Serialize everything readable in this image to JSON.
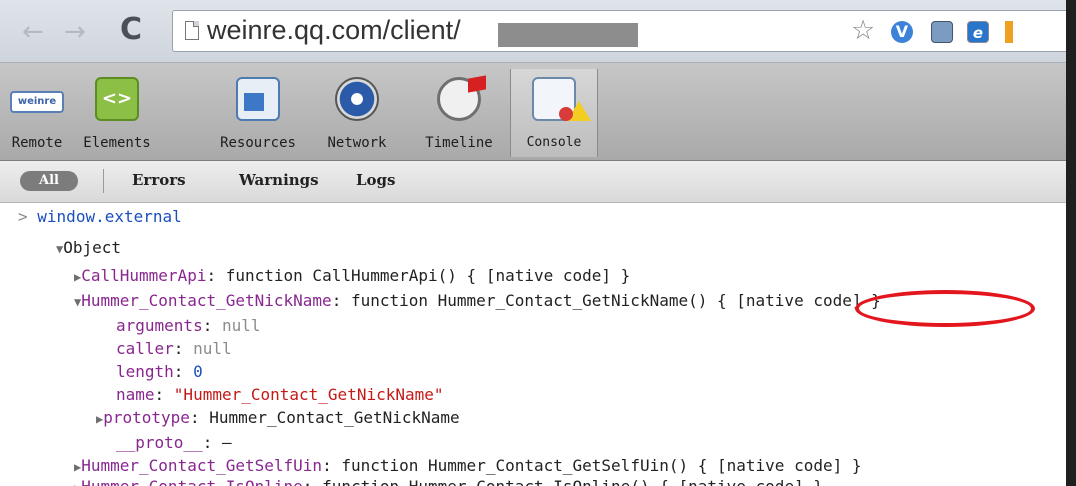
{
  "browser": {
    "back_glyph": "←",
    "forward_glyph": "→",
    "reload_glyph": "C",
    "url": "weinre.qq.com/client/",
    "star_glyph": "☆",
    "ext_v": "V",
    "ext_ie": "e"
  },
  "panel_tabs": {
    "remote": "Remote",
    "remote_logo": "weinre",
    "elements": "Elements",
    "elements_glyph": "<>",
    "resources": "Resources",
    "network": "Network",
    "timeline": "Timeline",
    "console": "Console"
  },
  "filters": {
    "all": "All",
    "errors": "Errors",
    "warnings": "Warnings",
    "logs": "Logs"
  },
  "console": {
    "prompt": ">",
    "command": "window.external",
    "object_label": "Object",
    "rows": {
      "callhummer_key": "CallHummerApi",
      "callhummer_val": "function CallHummerApi() { [native code] }",
      "getnick_key": "Hummer_Contact_GetNickName",
      "getnick_val_pre": "function Hummer_Contact_GetNickName() { ",
      "getnick_val_native": "[native code]",
      "getnick_val_post": " }",
      "args_key": "arguments",
      "args_val": "null",
      "caller_key": "caller",
      "caller_val": "null",
      "length_key": "length",
      "length_val": "0",
      "name_key": "name",
      "name_val": "\"Hummer_Contact_GetNickName\"",
      "prototype_key": "prototype",
      "prototype_val": "Hummer_Contact_GetNickName",
      "proto_key": "__proto__",
      "proto_val": "–",
      "selfuin_key": "Hummer_Contact_GetSelfUin",
      "selfuin_val": "function Hummer_Contact_GetSelfUin() { [native code] }",
      "online_key": "Hummer_Contact_IsOnline",
      "online_val": "function Hummer_Contact_IsOnline() { [native code] }"
    }
  },
  "colors": {
    "highlight": "#e3161d",
    "property_key": "#88278f",
    "string_value": "#c41a16",
    "command": "#1a4fbf"
  }
}
